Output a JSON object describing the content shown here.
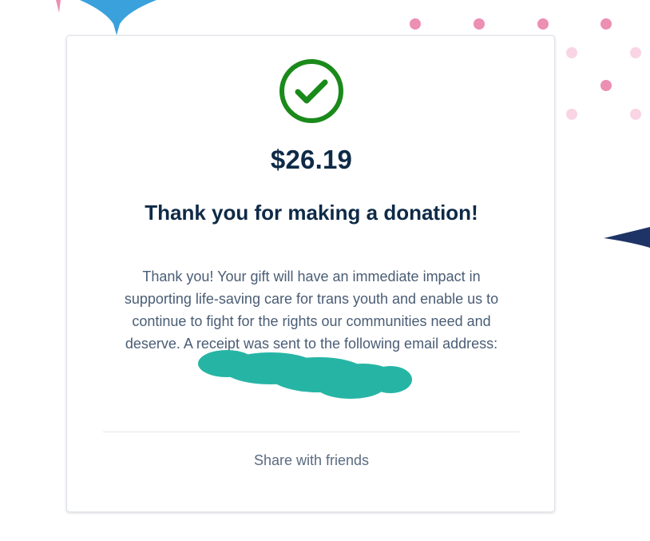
{
  "confirmation": {
    "amount": "$26.19",
    "title": "Thank you for making a donation!",
    "message": "Thank you! Your gift will have an immediate impact in supporting life-saving care for trans youth and enable us to continue to fight for the rights our communities need and deserve. A receipt was sent to the following email address:",
    "status_icon": "check-circle-icon",
    "email_redacted": true
  },
  "share": {
    "label": "Share with friends"
  },
  "colors": {
    "success": "#1a8a1a",
    "heading": "#0e2a47",
    "body_text": "#4a5d75",
    "redaction": "#26b5a5",
    "accent_blue": "#3aa1dd",
    "accent_navy": "#1f3466",
    "accent_pink": "#ec8fb3"
  }
}
